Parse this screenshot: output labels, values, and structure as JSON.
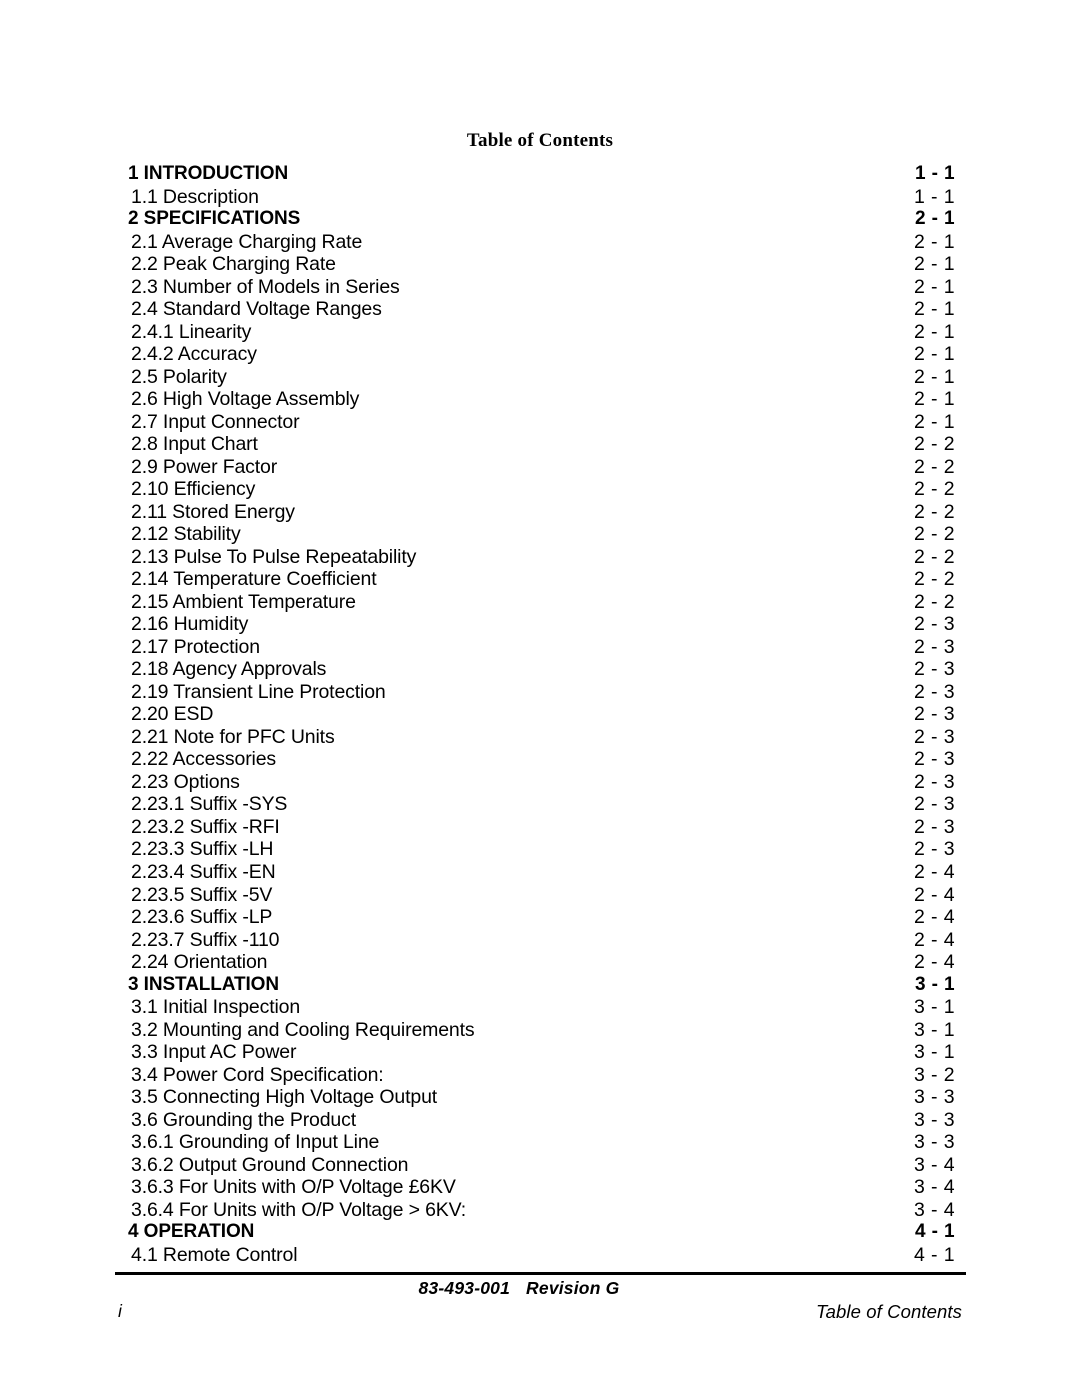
{
  "document": {
    "title": "Table of Contents"
  },
  "toc": {
    "entries": [
      {
        "label": "1 INTRODUCTION",
        "page": "1 - 1",
        "level": 1
      },
      {
        "label": "1.1 Description",
        "page": "1 - 1",
        "level": 2
      },
      {
        "label": "2 SPECIFICATIONS",
        "page": "2 - 1",
        "level": 1
      },
      {
        "label": "2.1 Average Charging Rate",
        "page": "2 - 1",
        "level": 2
      },
      {
        "label": "2.2 Peak Charging Rate",
        "page": "2 - 1",
        "level": 2
      },
      {
        "label": "2.3 Number of Models in Series",
        "page": "2 - 1",
        "level": 2
      },
      {
        "label": "2.4 Standard Voltage Ranges",
        "page": "2 - 1",
        "level": 2
      },
      {
        "label": "2.4.1 Linearity",
        "page": "2 - 1",
        "level": 3
      },
      {
        "label": "2.4.2 Accuracy",
        "page": "2 - 1",
        "level": 3
      },
      {
        "label": "2.5 Polarity",
        "page": "2 - 1",
        "level": 2
      },
      {
        "label": "2.6 High Voltage Assembly",
        "page": "2 - 1",
        "level": 2
      },
      {
        "label": "2.7 Input Connector",
        "page": "2 - 1",
        "level": 2
      },
      {
        "label": "2.8 Input Chart",
        "page": "2 - 2",
        "level": 2
      },
      {
        "label": "2.9 Power Factor",
        "page": "2 - 2",
        "level": 2
      },
      {
        "label": "2.10 Efficiency",
        "page": "2 - 2",
        "level": 2
      },
      {
        "label": "2.11 Stored Energy",
        "page": "2 - 2",
        "level": 2
      },
      {
        "label": "2.12 Stability",
        "page": "2 - 2",
        "level": 2
      },
      {
        "label": "2.13 Pulse To Pulse Repeatability",
        "page": "2 - 2",
        "level": 2
      },
      {
        "label": "2.14 Temperature Coefficient",
        "page": "2 - 2",
        "level": 2
      },
      {
        "label": "2.15 Ambient Temperature",
        "page": "2 - 2",
        "level": 2
      },
      {
        "label": "2.16 Humidity",
        "page": "2 - 3",
        "level": 2
      },
      {
        "label": "2.17 Protection",
        "page": "2 - 3",
        "level": 2
      },
      {
        "label": "2.18 Agency Approvals",
        "page": "2 - 3",
        "level": 2
      },
      {
        "label": "2.19 Transient Line Protection",
        "page": "2 - 3",
        "level": 2
      },
      {
        "label": "2.20 ESD",
        "page": "2 - 3",
        "level": 2
      },
      {
        "label": "2.21 Note for PFC Units",
        "page": "2 - 3",
        "level": 2
      },
      {
        "label": "2.22 Accessories",
        "page": "2 - 3",
        "level": 2
      },
      {
        "label": "2.23 Options",
        "page": "2 - 3",
        "level": 2
      },
      {
        "label": "2.23.1 Suffix -SYS",
        "page": "2 - 3",
        "level": 3
      },
      {
        "label": "2.23.2 Suffix -RFI",
        "page": "2 - 3",
        "level": 3
      },
      {
        "label": "2.23.3 Suffix -LH",
        "page": "2 - 3",
        "level": 3
      },
      {
        "label": "2.23.4 Suffix -EN",
        "page": "2 - 4",
        "level": 3
      },
      {
        "label": "2.23.5 Suffix -5V",
        "page": "2 - 4",
        "level": 3
      },
      {
        "label": "2.23.6 Suffix -LP",
        "page": "2 - 4",
        "level": 3
      },
      {
        "label": "2.23.7 Suffix -110",
        "page": "2 - 4",
        "level": 3
      },
      {
        "label": "2.24 Orientation",
        "page": "2 - 4",
        "level": 2
      },
      {
        "label": "3 INSTALLATION",
        "page": "3 - 1",
        "level": 1
      },
      {
        "label": "3.1 Initial Inspection",
        "page": "3 - 1",
        "level": 2
      },
      {
        "label": "3.2 Mounting and Cooling Requirements",
        "page": "3 - 1",
        "level": 2
      },
      {
        "label": "3.3 Input AC Power",
        "page": "3 - 1",
        "level": 2
      },
      {
        "label": "3.4 Power Cord Specification:",
        "page": "3 - 2",
        "level": 2
      },
      {
        "label": "3.5 Connecting High Voltage Output",
        "page": "3 - 3",
        "level": 2
      },
      {
        "label": "3.6 Grounding the Product",
        "page": "3 - 3",
        "level": 2
      },
      {
        "label": "3.6.1 Grounding of Input Line",
        "page": "3 - 3",
        "level": 3
      },
      {
        "label": "3.6.2 Output Ground Connection",
        "page": "3 - 4",
        "level": 3
      },
      {
        "label": "3.6.3 For Units with O/P Voltage £6KV",
        "page": "3 - 4",
        "level": 3
      },
      {
        "label": "3.6.4 For Units with O/P Voltage > 6KV:",
        "page": "3 - 4",
        "level": 3
      },
      {
        "label": "4 OPERATION",
        "page": "4 - 1",
        "level": 1
      },
      {
        "label": "4.1 Remote Control",
        "page": "4 - 1",
        "level": 2
      }
    ]
  },
  "footer": {
    "document_number": "83-493-001",
    "revision": "Revision G",
    "page_number": "i",
    "section_name": "Table of Contents"
  }
}
